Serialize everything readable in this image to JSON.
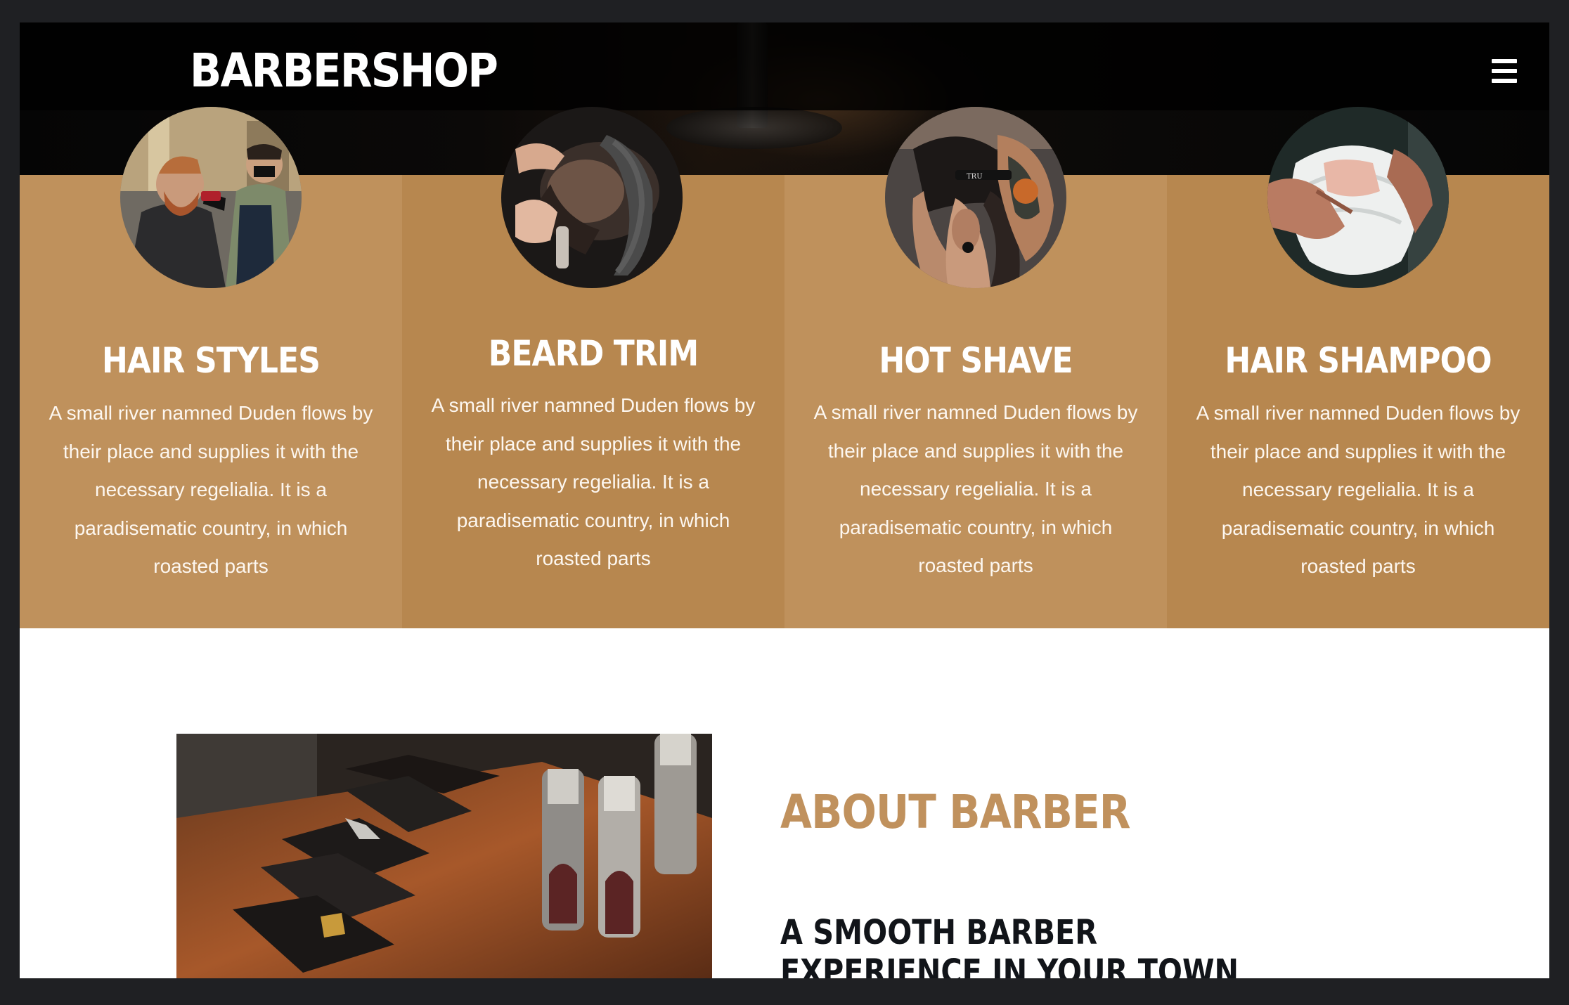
{
  "header": {
    "brand": "BARBERSHOP",
    "menu_icon": "hamburger-menu-icon"
  },
  "services": [
    {
      "title": "HAIR STYLES",
      "image": "barber-styling-photo",
      "desc_lines": [
        "A small river namned Duden flows by",
        "their place and supplies it with the",
        "necessary regelialia. It is a",
        "paradisematic country, in which",
        "roasted parts"
      ]
    },
    {
      "title": "BEARD TRIM",
      "image": "beard-trim-photo",
      "desc_lines": [
        "A small river namned Duden flows by",
        "their place and supplies it with the",
        "necessary regelialia. It is a",
        "paradisematic country, in which",
        "roasted parts"
      ]
    },
    {
      "title": "HOT SHAVE",
      "image": "hot-shave-photo",
      "desc_lines": [
        "A small river namned Duden flows by",
        "their place and supplies it with the",
        "necessary regelialia. It is a",
        "paradisematic country, in which",
        "roasted parts"
      ]
    },
    {
      "title": "HAIR SHAMPOO",
      "image": "towel-shampoo-photo",
      "desc_lines": [
        "A small river namned Duden flows by",
        "their place and supplies it with the",
        "necessary regelialia. It is a",
        "paradisematic country, in which",
        "roasted parts"
      ]
    }
  ],
  "about": {
    "title": "ABOUT BARBER",
    "subtitle": "A SMOOTH BARBER EXPERIENCE IN YOUR TOWN",
    "image": "hair-clippers-photo"
  },
  "colors": {
    "accent": "#c0915d",
    "panel_light": "#bf915c",
    "panel_dark": "#b7874f",
    "heading_dark": "#111419"
  }
}
